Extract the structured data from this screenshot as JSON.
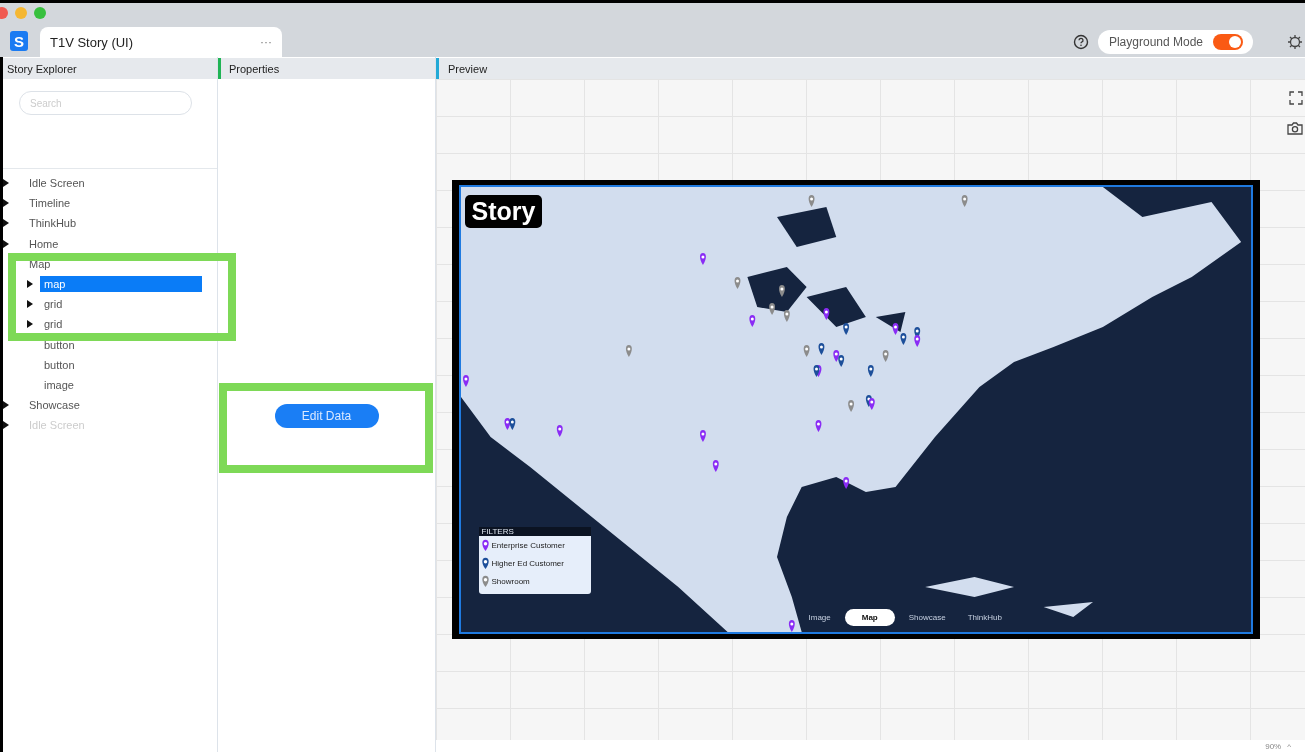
{
  "app_tab": {
    "logo": "S",
    "title": "T1V Story (UI)",
    "menu": "···"
  },
  "toolbar": {
    "mode_label": "Playground Mode",
    "mode_on": true
  },
  "panels": {
    "explorer": "Story Explorer",
    "properties": "Properties",
    "preview": "Preview"
  },
  "search": {
    "placeholder": "Search"
  },
  "tree": [
    {
      "label": "Idle Screen",
      "kind": "folder",
      "selected": false,
      "disabled": false
    },
    {
      "label": "Timeline",
      "kind": "folder",
      "selected": false,
      "disabled": false
    },
    {
      "label": "ThinkHub",
      "kind": "folder",
      "selected": false,
      "disabled": false
    },
    {
      "label": "Home",
      "kind": "folder",
      "selected": false,
      "disabled": false
    },
    {
      "label": "Map",
      "kind": "group",
      "selected": false,
      "disabled": false,
      "children": [
        {
          "label": "map",
          "kind": "folder",
          "selected": true,
          "disabled": false
        },
        {
          "label": "grid",
          "kind": "folder",
          "selected": false,
          "disabled": false
        },
        {
          "label": "grid",
          "kind": "folder",
          "selected": false,
          "disabled": false
        },
        {
          "label": "button",
          "kind": "leaf",
          "selected": false,
          "disabled": false
        },
        {
          "label": "button",
          "kind": "leaf",
          "selected": false,
          "disabled": false
        },
        {
          "label": "image",
          "kind": "leaf",
          "selected": false,
          "disabled": false
        }
      ]
    },
    {
      "label": "Showcase",
      "kind": "folder",
      "selected": false,
      "disabled": false
    },
    {
      "label": "Idle Screen",
      "kind": "folder",
      "selected": false,
      "disabled": true
    }
  ],
  "edit_button": "Edit Data",
  "story_preview": {
    "logo": "Story",
    "filters_title": "FILTERS",
    "legend": [
      {
        "label": "Enterprise Customer",
        "color": "#8a2cf5"
      },
      {
        "label": "Higher Ed Customer",
        "color": "#1d4f9a"
      },
      {
        "label": "Showroom",
        "color": "#8c8c8c"
      }
    ],
    "nav": [
      {
        "label": "Image",
        "selected": false
      },
      {
        "label": "Map",
        "selected": true
      },
      {
        "label": "Showcase",
        "selected": false
      },
      {
        "label": "ThinkHub",
        "selected": false
      }
    ]
  },
  "footer": {
    "zoom": "90%",
    "toggle": "^"
  }
}
